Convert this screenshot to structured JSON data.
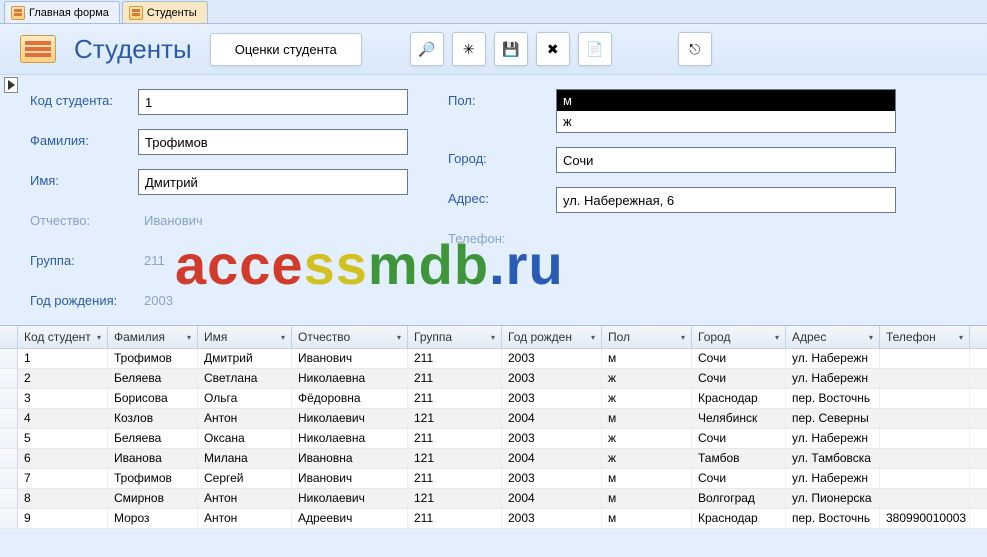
{
  "tabs": [
    {
      "label": "Главная форма",
      "active": false
    },
    {
      "label": "Студенты",
      "active": true
    }
  ],
  "header": {
    "title": "Студенты",
    "grades_button": "Оценки студента"
  },
  "form": {
    "left": {
      "student_id_label": "Код студента:",
      "student_id": "1",
      "lastname_label": "Фамилия:",
      "lastname": "Трофимов",
      "firstname_label": "Имя:",
      "firstname": "Дмитрий",
      "patronymic_label": "Отчество:",
      "patronymic": "Иванович",
      "group_label": "Группа:",
      "group": "211",
      "birthyear_label": "Год рождения:",
      "birthyear": "2003"
    },
    "right": {
      "gender_label": "Пол:",
      "gender_options": [
        "м",
        "ж"
      ],
      "gender_selected": "м",
      "city_label": "Город:",
      "city": "Сочи",
      "address_label": "Адрес:",
      "address": "ул. Набережная, 6",
      "phone_label": "Телефон:"
    }
  },
  "watermark": {
    "p1": "acce",
    "p2": "ss",
    "p3": "mdb",
    "p4": ".ru"
  },
  "grid": {
    "headers": [
      "Код студент",
      "Фамилия",
      "Имя",
      "Отчество",
      "Группа",
      "Год рожден",
      "Пол",
      "Город",
      "Адрес",
      "Телефон"
    ],
    "rows": [
      {
        "id": "1",
        "lastname": "Трофимов",
        "firstname": "Дмитрий",
        "patronymic": "Иванович",
        "group": "211",
        "year": "2003",
        "gender": "м",
        "city": "Сочи",
        "address": "ул. Набережн",
        "phone": ""
      },
      {
        "id": "2",
        "lastname": "Беляева",
        "firstname": "Светлана",
        "patronymic": "Николаевна",
        "group": "211",
        "year": "2003",
        "gender": "ж",
        "city": "Сочи",
        "address": "ул. Набережн",
        "phone": ""
      },
      {
        "id": "3",
        "lastname": "Борисова",
        "firstname": "Ольга",
        "patronymic": "Фёдоровна",
        "group": "211",
        "year": "2003",
        "gender": "ж",
        "city": "Краснодар",
        "address": "пер. Восточнь",
        "phone": ""
      },
      {
        "id": "4",
        "lastname": "Козлов",
        "firstname": "Антон",
        "patronymic": "Николаевич",
        "group": "121",
        "year": "2004",
        "gender": "м",
        "city": "Челябинск",
        "address": "пер. Северны",
        "phone": ""
      },
      {
        "id": "5",
        "lastname": "Беляева",
        "firstname": "Оксана",
        "patronymic": "Николаевна",
        "group": "211",
        "year": "2003",
        "gender": "ж",
        "city": "Сочи",
        "address": "ул. Набережн",
        "phone": ""
      },
      {
        "id": "6",
        "lastname": "Иванова",
        "firstname": "Милана",
        "patronymic": "Ивановна",
        "group": "121",
        "year": "2004",
        "gender": "ж",
        "city": "Тамбов",
        "address": "ул. Тамбовска",
        "phone": ""
      },
      {
        "id": "7",
        "lastname": "Трофимов",
        "firstname": "Сергей",
        "patronymic": "Иванович",
        "group": "211",
        "year": "2003",
        "gender": "м",
        "city": "Сочи",
        "address": "ул. Набережн",
        "phone": ""
      },
      {
        "id": "8",
        "lastname": "Смирнов",
        "firstname": "Антон",
        "patronymic": "Николаевич",
        "group": "121",
        "year": "2004",
        "gender": "м",
        "city": "Волгоград",
        "address": "ул. Пионерска",
        "phone": ""
      },
      {
        "id": "9",
        "lastname": "Мороз",
        "firstname": "Антон",
        "patronymic": "Адреевич",
        "group": "211",
        "year": "2003",
        "gender": "м",
        "city": "Краснодар",
        "address": "пер. Восточнь",
        "phone": "380990010003"
      }
    ]
  }
}
